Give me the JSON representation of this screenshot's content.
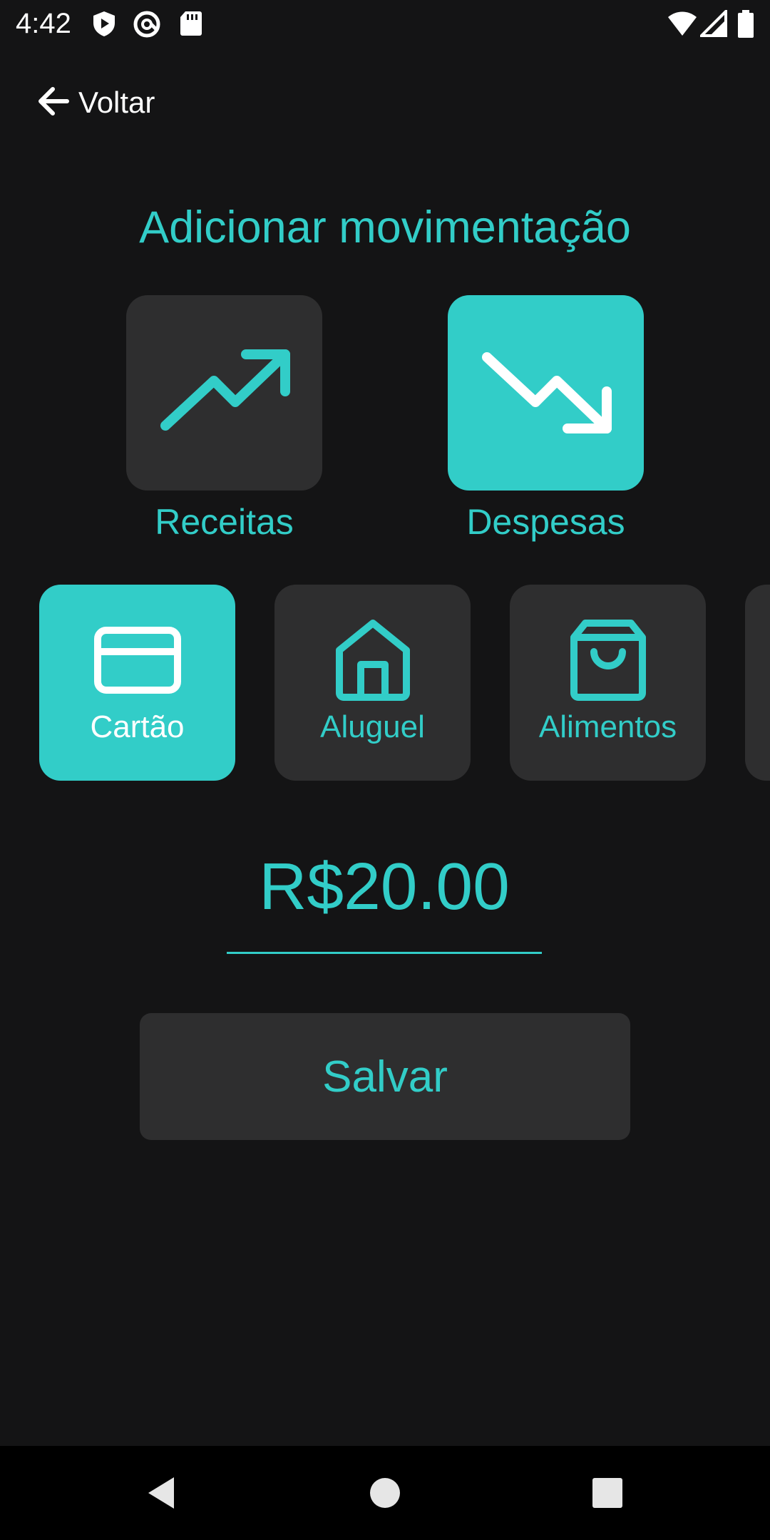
{
  "status_bar": {
    "time": "4:42",
    "left_icons": [
      "shield-play-icon",
      "at-sign-icon",
      "sd-card-icon"
    ],
    "right_icons": [
      "wifi-icon",
      "cellular-signal-icon",
      "battery-icon"
    ]
  },
  "header": {
    "back_label": "Voltar",
    "back_icon": "arrow-left-icon"
  },
  "page": {
    "title": "Adicionar movimentação"
  },
  "types": [
    {
      "label": "Receitas",
      "icon": "trending-up-icon",
      "selected": false
    },
    {
      "label": "Despesas",
      "icon": "trending-down-icon",
      "selected": true
    }
  ],
  "categories": [
    {
      "label": "Cartão",
      "icon": "credit-card-icon",
      "selected": true
    },
    {
      "label": "Aluguel",
      "icon": "home-icon",
      "selected": false
    },
    {
      "label": "Alimentos",
      "icon": "shopping-bag-icon",
      "selected": false
    },
    {
      "label": "",
      "icon": "",
      "selected": false
    }
  ],
  "amount": {
    "value": "R$20.00"
  },
  "actions": {
    "save_label": "Salvar"
  },
  "nav": {
    "items": [
      "back-triangle-icon",
      "home-circle-icon",
      "recents-square-icon"
    ]
  },
  "colors": {
    "accent": "#32cdc8",
    "background": "#141415",
    "card": "#2e2e2f",
    "white": "#ffffff"
  }
}
